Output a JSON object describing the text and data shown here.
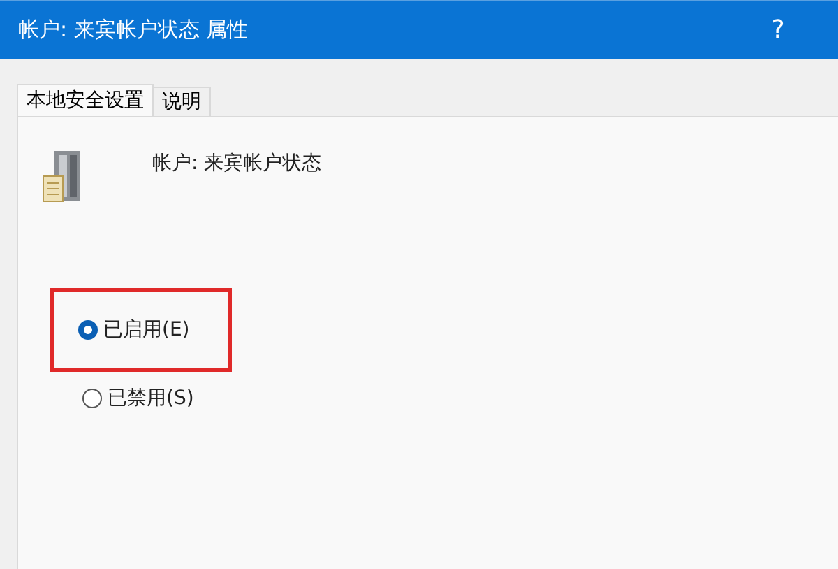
{
  "window": {
    "title": "帐户: 来宾帐户状态 属性",
    "help": "?"
  },
  "tabs": [
    {
      "label": "本地安全设置",
      "selected": true
    },
    {
      "label": "说明",
      "selected": false
    }
  ],
  "policy": {
    "label": "帐户: 来宾帐户状态"
  },
  "options": [
    {
      "label": "已启用(E)",
      "selected": true,
      "highlighted": true
    },
    {
      "label": "已禁用(S)",
      "selected": false,
      "highlighted": false
    }
  ]
}
